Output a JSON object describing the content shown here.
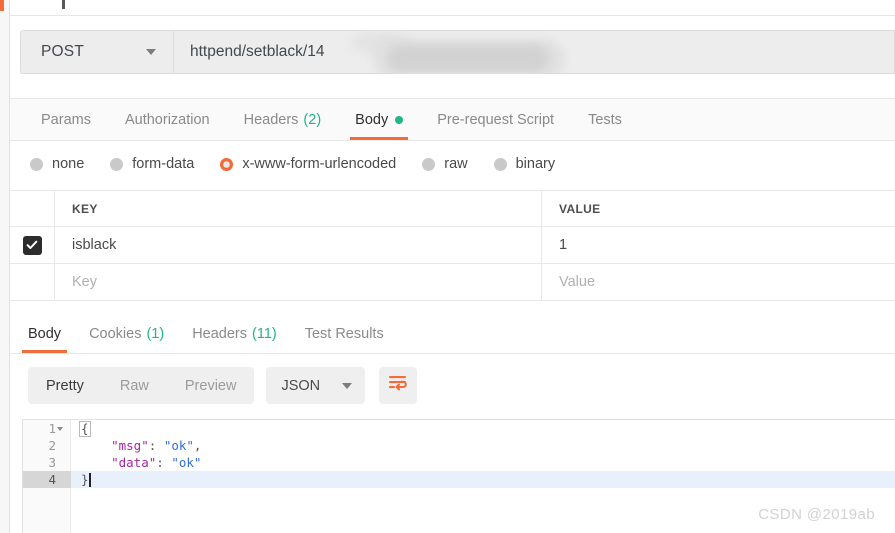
{
  "request": {
    "method": "POST",
    "url_prefix": "http",
    "url_suffix": "end/setblack/14",
    "url_redacted": true,
    "tabs": [
      {
        "label": "Params",
        "count": "",
        "active": false,
        "dot": false
      },
      {
        "label": "Authorization",
        "count": "",
        "active": false,
        "dot": false
      },
      {
        "label": "Headers",
        "count": "(2)",
        "active": false,
        "dot": false
      },
      {
        "label": "Body",
        "count": "",
        "active": true,
        "dot": true
      },
      {
        "label": "Pre-request Script",
        "count": "",
        "active": false,
        "dot": false
      },
      {
        "label": "Tests",
        "count": "",
        "active": false,
        "dot": false
      }
    ],
    "body_types": [
      {
        "label": "none",
        "selected": false
      },
      {
        "label": "form-data",
        "selected": false
      },
      {
        "label": "x-www-form-urlencoded",
        "selected": true
      },
      {
        "label": "raw",
        "selected": false
      },
      {
        "label": "binary",
        "selected": false
      }
    ],
    "params_table": {
      "columns": [
        "KEY",
        "VALUE"
      ],
      "rows": [
        {
          "checked": true,
          "key": "isblack",
          "value": "1",
          "placeholder_row": false
        },
        {
          "checked": false,
          "key": "Key",
          "value": "Value",
          "placeholder_row": true
        }
      ]
    }
  },
  "response": {
    "tabs": [
      {
        "label": "Body",
        "count": "",
        "active": true
      },
      {
        "label": "Cookies",
        "count": "(1)",
        "active": false
      },
      {
        "label": "Headers",
        "count": "(11)",
        "active": false
      },
      {
        "label": "Test Results",
        "count": "",
        "active": false
      }
    ],
    "view_modes": [
      {
        "label": "Pretty",
        "active": true
      },
      {
        "label": "Raw",
        "active": false
      },
      {
        "label": "Preview",
        "active": false
      }
    ],
    "format": "JSON",
    "wrap_icon": "wrap-text-icon",
    "body_lines": [
      {
        "number": "1",
        "foldable": true,
        "active": false,
        "tokens": [
          {
            "t": "punct",
            "v": "{",
            "boxed": true
          }
        ]
      },
      {
        "number": "2",
        "foldable": false,
        "active": false,
        "tokens": [
          {
            "t": "plain",
            "v": "    "
          },
          {
            "t": "key",
            "v": "\"msg\""
          },
          {
            "t": "punct",
            "v": ": "
          },
          {
            "t": "str",
            "v": "\"ok\""
          },
          {
            "t": "punct",
            "v": ","
          }
        ]
      },
      {
        "number": "3",
        "foldable": false,
        "active": false,
        "tokens": [
          {
            "t": "plain",
            "v": "    "
          },
          {
            "t": "key",
            "v": "\"data\""
          },
          {
            "t": "punct",
            "v": ": "
          },
          {
            "t": "str",
            "v": "\"ok\""
          }
        ]
      },
      {
        "number": "4",
        "foldable": false,
        "active": true,
        "caret": true,
        "tokens": [
          {
            "t": "punct",
            "v": "}"
          }
        ]
      }
    ]
  },
  "watermark": "CSDN @2019ab",
  "colors": {
    "accent": "#f26b3a",
    "green": "#22b587",
    "json_key": "#a626a4",
    "json_string": "#2f6fd0",
    "active_line": "#e8f1fb"
  }
}
